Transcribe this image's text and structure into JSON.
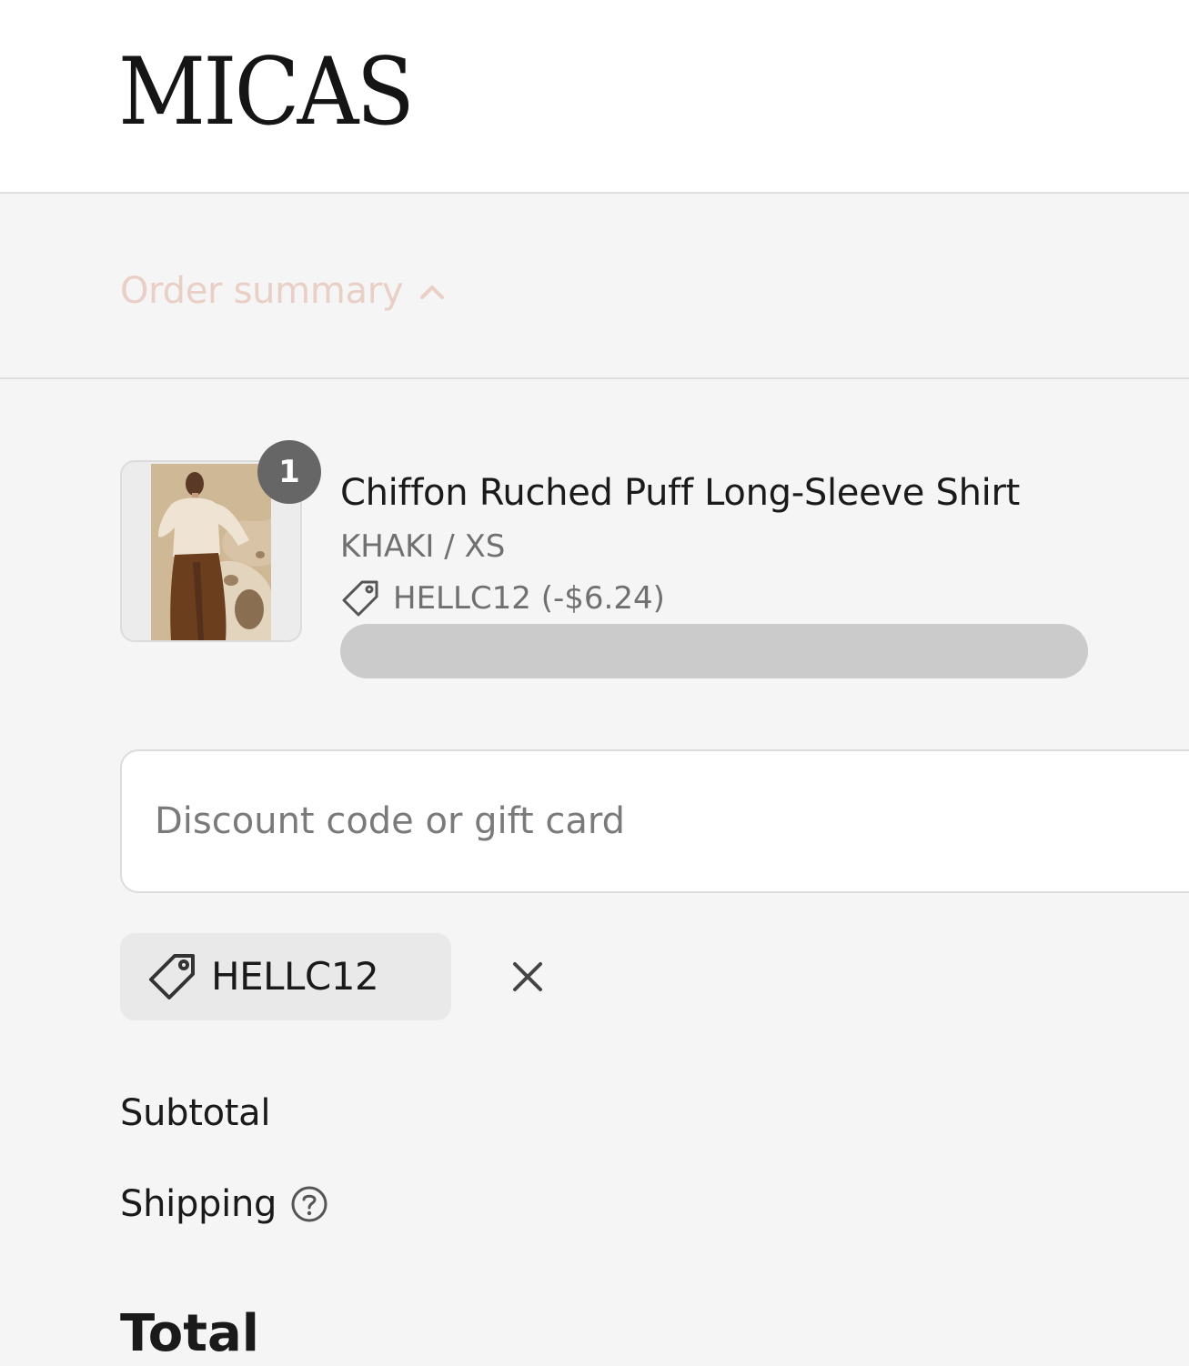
{
  "brand": {
    "logo_text": "MICAS"
  },
  "order_summary": {
    "label": "Order summary",
    "chevron_icon": "chevron-up-icon",
    "label_color": "#e9cfc6"
  },
  "cart": {
    "items": [
      {
        "quantity": "1",
        "title": "Chiffon Ruched Puff Long-Sleeve Shirt",
        "variant": "KHAKI / XS",
        "discount_icon": "tag-icon",
        "discount": "HELLC12 (-$6.24)"
      }
    ]
  },
  "discount": {
    "placeholder": "Discount code or gift card",
    "value": "",
    "applied_code": "HELLC12",
    "applied_icon": "tag-icon",
    "remove_icon": "close-icon"
  },
  "totals": {
    "subtotal_label": "Subtotal",
    "shipping_label": "Shipping",
    "shipping_help_icon": "help-circle-icon",
    "total_label": "Total"
  }
}
